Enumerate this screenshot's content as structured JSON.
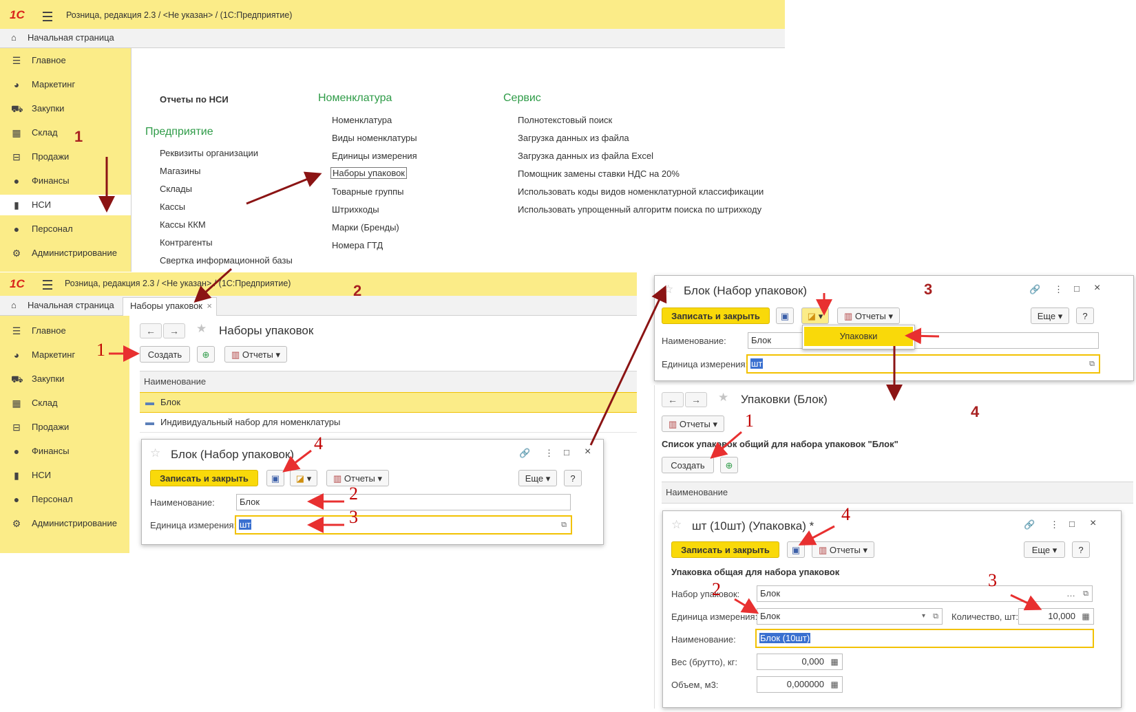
{
  "top": {
    "titlebar": "Розница, редакция 2.3 / <Не указан> / (1С:Предприятие)",
    "home_tab": "Начальная страница",
    "sidebar": [
      "Главное",
      "Маркетинг",
      "Закупки",
      "Склад",
      "Продажи",
      "Финансы",
      "НСИ",
      "Персонал",
      "Администрирование"
    ],
    "sections": {
      "reports_title": "Отчеты по НСИ",
      "enterprise_title": "Предприятие",
      "enterprise_items": [
        "Реквизиты организации",
        "Магазины",
        "Склады",
        "Кассы",
        "Кассы ККМ",
        "Контрагенты",
        "Свертка информационной базы"
      ],
      "nomenclature_title": "Номенклатура",
      "nomenclature_items": [
        "Номенклатура",
        "Виды номенклатуры",
        "Единицы измерения",
        "Наборы упаковок",
        "Товарные группы",
        "Штрихкоды",
        "Марки (Бренды)",
        "Номера ГТД"
      ],
      "service_title": "Сервис",
      "service_items": [
        "Полнотекстовый поиск",
        "Загрузка данных из файла",
        "Загрузка данных из файла Excel",
        "Помощник замены ставки НДС на 20%",
        "Использовать коды видов номенклатурной классификации",
        "Использовать упрощенный алгоритм поиска по штрихкоду"
      ]
    }
  },
  "second": {
    "titlebar": "Розница, редакция 2.3 / <Не указан> / (1С:Предприятие)",
    "home_tab": "Начальная страница",
    "active_tab": "Наборы упаковок",
    "page_title": "Наборы упаковок",
    "create_btn": "Создать",
    "reports_btn": "Отчеты",
    "col_name": "Наименование",
    "rows": [
      "Блок",
      "Индивидуальный набор для номенклатуры"
    ],
    "form": {
      "title": "Блок (Набор упаковок)",
      "save_close": "Записать и закрыть",
      "reports": "Отчеты",
      "more": "Еще",
      "help": "?",
      "name_label": "Наименование:",
      "name_value": "Блок",
      "unit_label": "Единица измерения:",
      "unit_value": "шт"
    }
  },
  "right_form": {
    "title": "Блок (Набор упаковок)",
    "save_close": "Записать и закрыть",
    "reports": "Отчеты",
    "more": "Еще",
    "help": "?",
    "menu_item": "Упаковки",
    "name_label": "Наименование:",
    "name_value": "Блок",
    "unit_label": "Единица измерения:",
    "unit_value": "шт"
  },
  "packages": {
    "title": "Упаковки (Блок)",
    "reports": "Отчеты",
    "list_caption": "Список упаковок общий для набора упаковок \"Блок\"",
    "create_btn": "Создать",
    "col_name": "Наименование"
  },
  "package_form": {
    "title": "шт (10шт) (Упаковка) *",
    "save_close": "Записать и закрыть",
    "reports": "Отчеты",
    "more": "Еще",
    "help": "?",
    "subtitle": "Упаковка общая для набора упаковок",
    "set_label": "Набор упаковок:",
    "set_value": "Блок",
    "unit_label": "Единица измерения:",
    "unit_value": "Блок",
    "qty_label": "Количество, шт:",
    "qty_value": "10,000",
    "name_label": "Наименование:",
    "name_value": "Блок (10шт)",
    "weight_label": "Вес (брутто), кг:",
    "weight_value": "0,000",
    "volume_label": "Объем, м3:",
    "volume_value": "0,000000"
  },
  "annotations": {
    "a1": "1",
    "a2": "2",
    "a3": "3",
    "a4": "4",
    "b1": "1",
    "b2": "2",
    "b3": "3",
    "b4": "4",
    "c1": "1",
    "c2": "2",
    "c3": "3",
    "c4": "4"
  }
}
